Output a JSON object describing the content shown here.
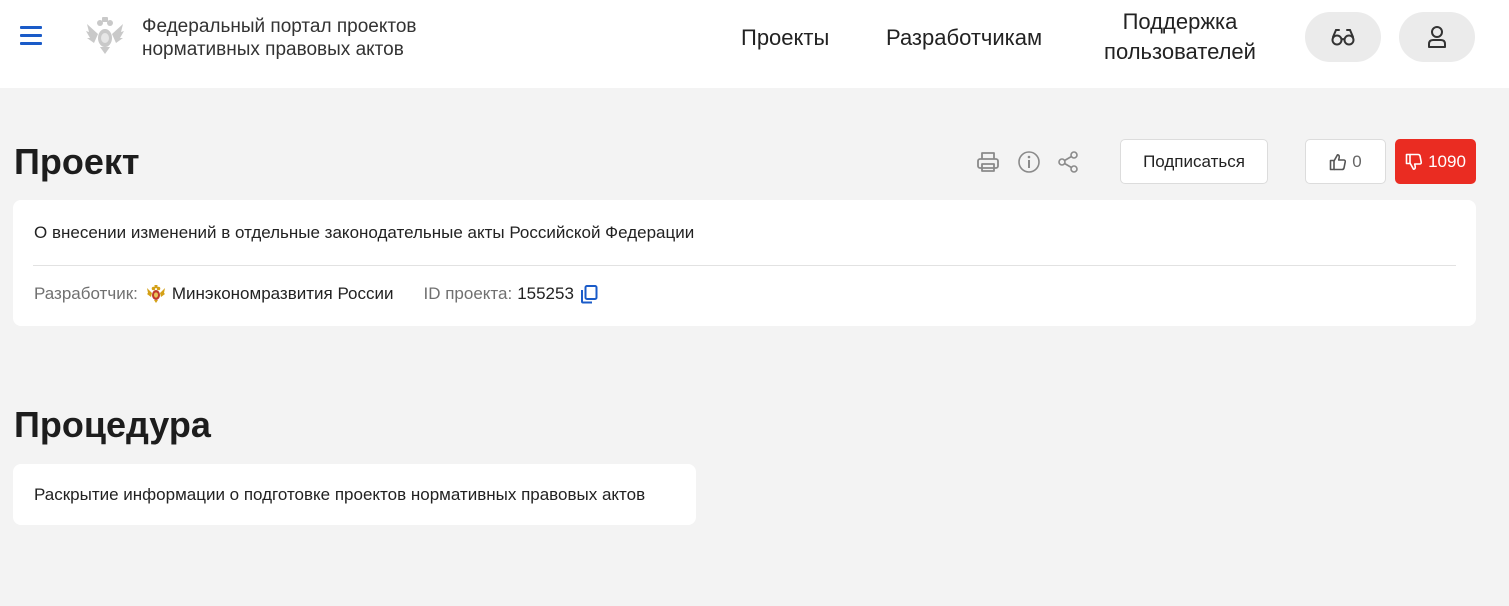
{
  "header": {
    "portal_title": "Федеральный портал проектов нормативных правовых актов",
    "nav": {
      "projects": "Проекты",
      "developers": "Разработчикам",
      "support": "Поддержка пользователей"
    },
    "icons": {
      "menu": "hamburger-menu-icon",
      "emblem": "russia-coat-of-arms",
      "accessibility": "glasses-icon",
      "profile": "user-icon"
    }
  },
  "project": {
    "heading": "Проект",
    "toolbar": {
      "icons": [
        "printer-icon",
        "info-icon",
        "share-icon"
      ],
      "subscribe_label": "Подписаться",
      "likes": "0",
      "dislikes": "1090"
    },
    "title": "О внесении изменений в отдельные законодательные акты Российской Федерации",
    "developer_label": "Разработчик:",
    "developer_name": "Минэкономразвития России",
    "id_label": "ID проекта:",
    "id_value": "155253"
  },
  "procedure": {
    "heading": "Процедура",
    "text": "Раскрытие информации о подготовке проектов нормативных правовых актов"
  },
  "colors": {
    "accent_blue": "#1a5bc8",
    "dislike_red": "#ea2c22",
    "background": "#f3f3f3"
  }
}
